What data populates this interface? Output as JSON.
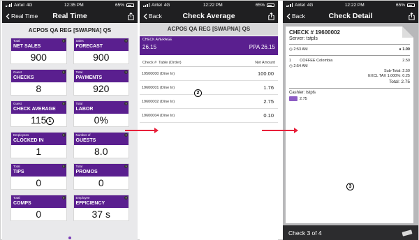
{
  "screen1": {
    "status": {
      "carrier": "Airtel",
      "network": "4G",
      "time": "12:35 PM",
      "battery": "65%"
    },
    "nav": {
      "back": "Real Time",
      "title": "Real Time"
    },
    "store": "ACPOS QA REG [SWAPNA] QS",
    "tiles": [
      {
        "pre": "Total",
        "label": "NET SALES",
        "value": "900"
      },
      {
        "pre": "Sales",
        "label": "FORECAST",
        "value": "900"
      },
      {
        "pre": "Guest",
        "label": "CHECKS",
        "value": "8"
      },
      {
        "pre": "Total",
        "label": "PAYMENTS",
        "value": "920"
      },
      {
        "pre": "Guest",
        "label": "CHECK AVERAGE",
        "value": "115"
      },
      {
        "pre": "Total",
        "label": "LABOR",
        "value": "0%"
      },
      {
        "pre": "Employees",
        "label": "CLOCKED IN",
        "value": "1"
      },
      {
        "pre": "Number of",
        "label": "GUESTS",
        "value": "8.0"
      },
      {
        "pre": "Total",
        "label": "TIPS",
        "value": "0"
      },
      {
        "pre": "Total",
        "label": "PROMOS",
        "value": "0"
      },
      {
        "pre": "Total",
        "label": "COMPS",
        "value": "0"
      },
      {
        "pre": "Employee",
        "label": "EFFICIENCY",
        "value": "37 s"
      }
    ],
    "marker": "1"
  },
  "screen2": {
    "status": {
      "carrier": "Airtel",
      "network": "4G",
      "time": "12:22 PM",
      "battery": "65%"
    },
    "nav": {
      "back": "Back",
      "title": "Check Average"
    },
    "store": "ACPOS QA REG [SWAPNA] QS",
    "ca_label": "CHECK AVERAGE",
    "ca_value": "26.15",
    "ppa": "PPA 26.15",
    "col_check": "Check #",
    "col_table": "Table (Order)",
    "col_amount": "Net Amount",
    "rows": [
      {
        "check": "19500000",
        "table": "(Dine In)",
        "amount": "100.00"
      },
      {
        "check": "19600001",
        "table": "(Dine In)",
        "amount": "1.76"
      },
      {
        "check": "19600002",
        "table": "(Dine In)",
        "amount": "2.75"
      },
      {
        "check": "19600004",
        "table": "(Dine In)",
        "amount": "0.10"
      }
    ],
    "marker": "2"
  },
  "screen3": {
    "status": {
      "carrier": "Airtel",
      "network": "4G",
      "time": "12:22 PM",
      "battery": "65%"
    },
    "nav": {
      "back": "Back",
      "title": "Check Detail"
    },
    "check": "CHECK # 19600002",
    "server": "Server: tstpls",
    "time1": "2:53 AM",
    "guests": "1.00",
    "item_qty": "1",
    "item_name": "COFFEE Colombia",
    "item_price": "2.50",
    "time2": "2:54 AM",
    "subtotal": "Sub-Total: 2.50",
    "tax": "EXCL TAX 1.000%: 0.25",
    "total": "Total: 2.75",
    "cashier": "Cashier: tstpls",
    "payment": "2.75",
    "footer": "Check 3 of 4",
    "marker": "3"
  },
  "colors": {
    "purple": "#5a1f8f",
    "dark": "#1f1f21",
    "arrow": "#e8203a"
  }
}
